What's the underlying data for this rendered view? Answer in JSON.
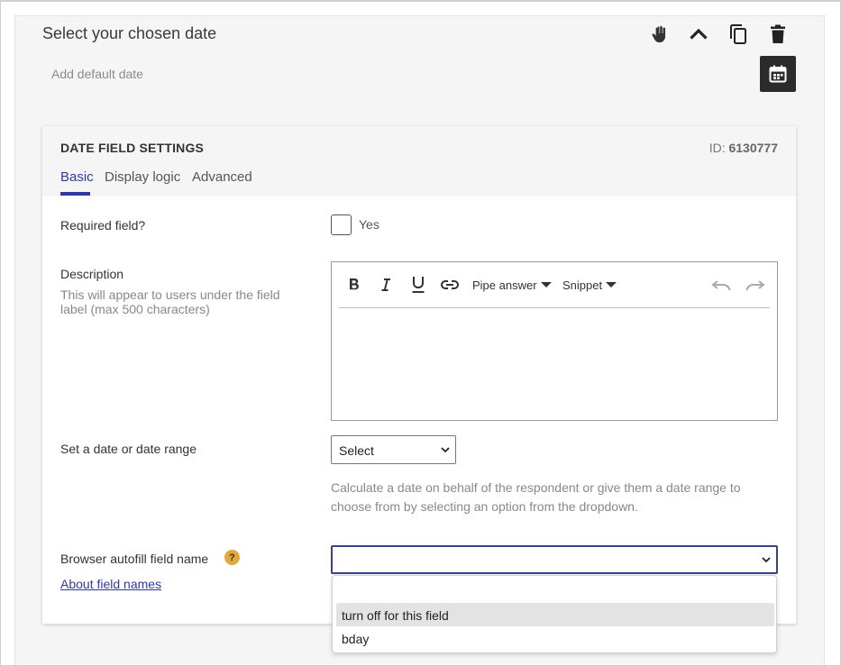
{
  "field": {
    "title": "Select your chosen date",
    "default_date_label": "Add default date"
  },
  "header_icons": [
    "drag-hand-icon",
    "chevron-up-icon",
    "copy-icon",
    "trash-icon"
  ],
  "settings": {
    "title": "DATE FIELD SETTINGS",
    "id_prefix": "ID:",
    "id_value": "6130777",
    "tabs": [
      {
        "label": "Basic",
        "active": true
      },
      {
        "label": "Display logic",
        "active": false
      },
      {
        "label": "Advanced",
        "active": false
      }
    ],
    "required": {
      "label": "Required field?",
      "option": "Yes",
      "checked": false
    },
    "description": {
      "label": "Description",
      "hint": "This will appear to users under the field label (max 500 characters)",
      "toolbar": {
        "pipe_answer": "Pipe answer",
        "snippet": "Snippet"
      }
    },
    "date_range": {
      "label": "Set a date or date range",
      "selected": "Select",
      "help": "Calculate a date on behalf of the respondent or give them a date range to choose from by selecting an option from the dropdown."
    },
    "autofill": {
      "label": "Browser autofill field name",
      "help_badge": "?",
      "link": "About field names",
      "value": "",
      "options": [
        "",
        "turn off for this field",
        "bday"
      ],
      "highlighted_index": 1
    }
  },
  "colors": {
    "accent": "#2f3a9e",
    "badge": "#e2a83b",
    "dark_button": "#2b2b2b"
  }
}
